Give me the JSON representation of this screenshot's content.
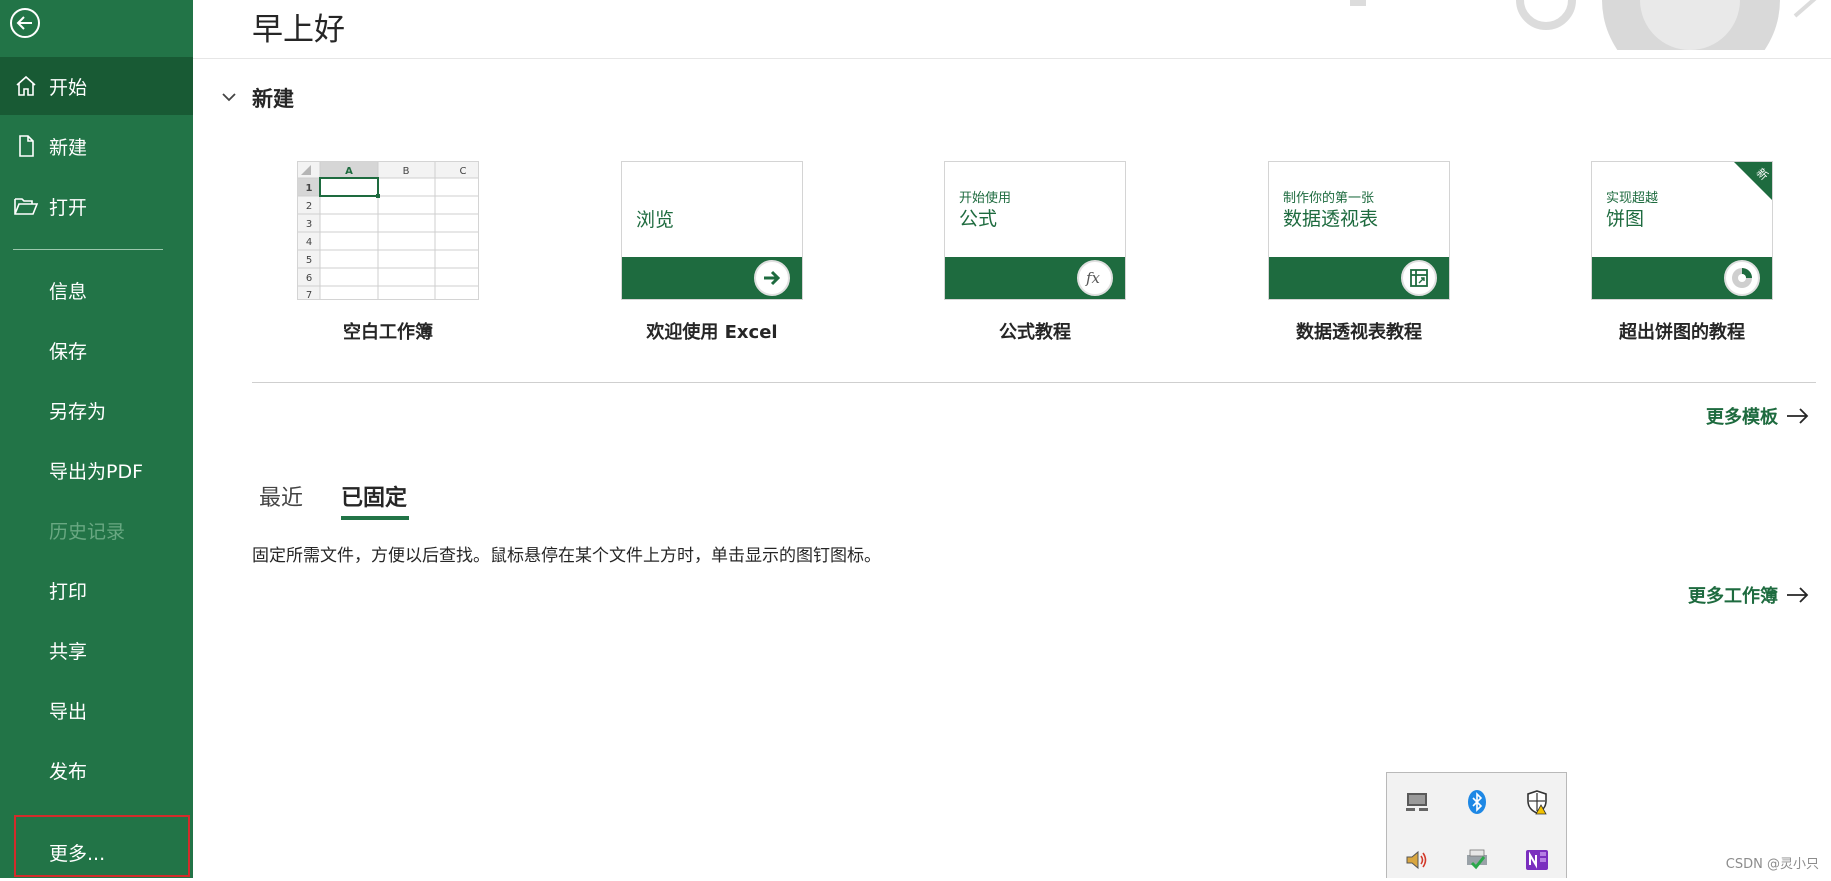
{
  "sidebar": {
    "items": [
      {
        "label": "开始",
        "icon": "home-icon",
        "active": true
      },
      {
        "label": "新建",
        "icon": "new-document-icon"
      },
      {
        "label": "打开",
        "icon": "open-folder-icon"
      },
      {
        "label": "信息"
      },
      {
        "label": "保存"
      },
      {
        "label": "另存为"
      },
      {
        "label": "导出为PDF"
      },
      {
        "label": "历史记录",
        "disabled": true
      },
      {
        "label": "打印"
      },
      {
        "label": "共享"
      },
      {
        "label": "导出"
      },
      {
        "label": "发布"
      },
      {
        "label": "更多..."
      }
    ],
    "colors": {
      "background": "#227447",
      "active": "#185a34",
      "highlight_border": "#d42b2b"
    }
  },
  "header": {
    "greeting": "早上好"
  },
  "new_section": {
    "title": "新建",
    "templates": [
      {
        "name": "空白工作簿"
      },
      {
        "name": "欢迎使用 Excel",
        "thumb_text": "浏览",
        "icon": "arrow-right-icon"
      },
      {
        "name": "公式教程",
        "thumb_small": "开始使用",
        "thumb_big": "公式",
        "icon": "fx-icon"
      },
      {
        "name": "数据透视表教程",
        "thumb_small": "制作你的第一张",
        "thumb_big": "数据透视表",
        "icon": "pivot-table-icon"
      },
      {
        "name": "超出饼图的教程",
        "thumb_small": "实现超越",
        "thumb_big": "饼图",
        "icon": "donut-chart-icon",
        "badge": "新"
      }
    ],
    "grid": {
      "columns": [
        "A",
        "B",
        "C"
      ],
      "rows": [
        "1",
        "2",
        "3",
        "4",
        "5",
        "6",
        "7"
      ]
    },
    "more_templates": "更多模板"
  },
  "files_section": {
    "tabs": [
      {
        "label": "最近"
      },
      {
        "label": "已固定",
        "active": true
      }
    ],
    "pinned_message": "固定所需文件，方便以后查找。鼠标悬停在某个文件上方时，单击显示的图钉图标。",
    "more_workbooks": "更多工作簿"
  },
  "tray": {
    "icons": [
      "network-icon",
      "bluetooth-icon",
      "security-warning-icon",
      "volume-icon",
      "printer-check-icon",
      "onenote-icon"
    ]
  },
  "watermark": "CSDN @灵小只",
  "colors": {
    "accent": "#1e6b3f",
    "text": "#262626"
  }
}
